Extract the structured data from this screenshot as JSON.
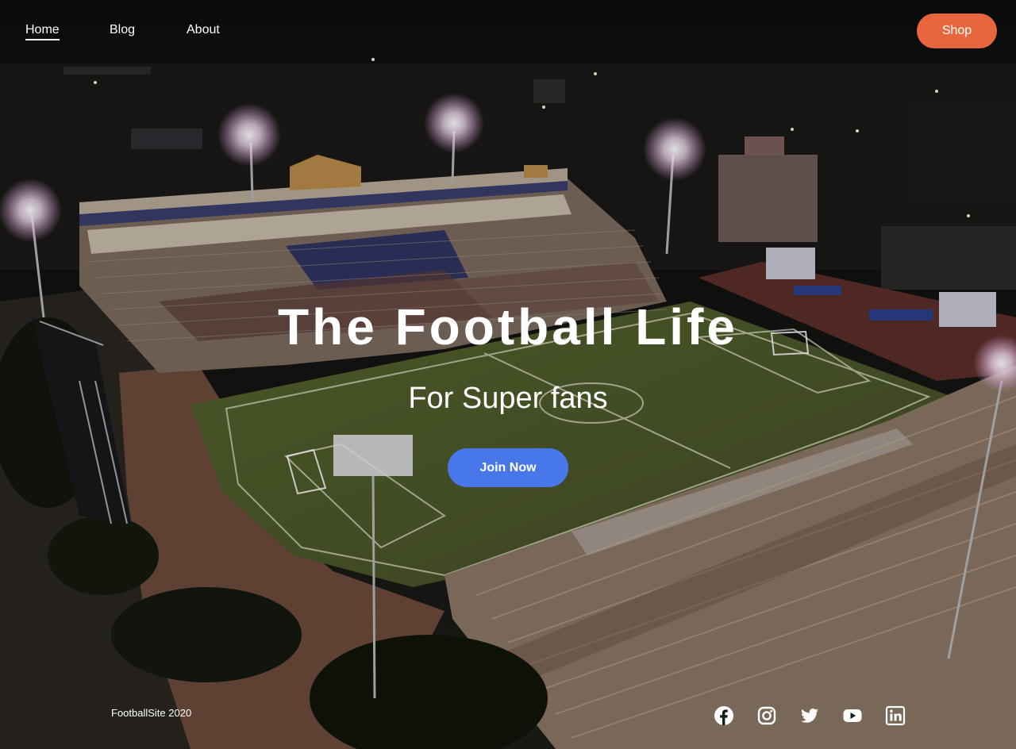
{
  "nav": {
    "home_label": "Home",
    "blog_label": "Blog",
    "about_label": "About",
    "shop_label": "Shop"
  },
  "hero": {
    "title": "The Football Life",
    "subtitle": "For Super fans",
    "cta_label": "Join Now"
  },
  "footer": {
    "copyright": "FootballSite 2020",
    "social_icons": [
      "facebook-icon",
      "instagram-icon",
      "twitter-icon",
      "youtube-icon",
      "linkedin-icon"
    ]
  },
  "colors": {
    "shop_button": "#e8663d",
    "join_button": "#4777e8",
    "text": "#ffffff",
    "pitch": "#4d5a2b"
  }
}
